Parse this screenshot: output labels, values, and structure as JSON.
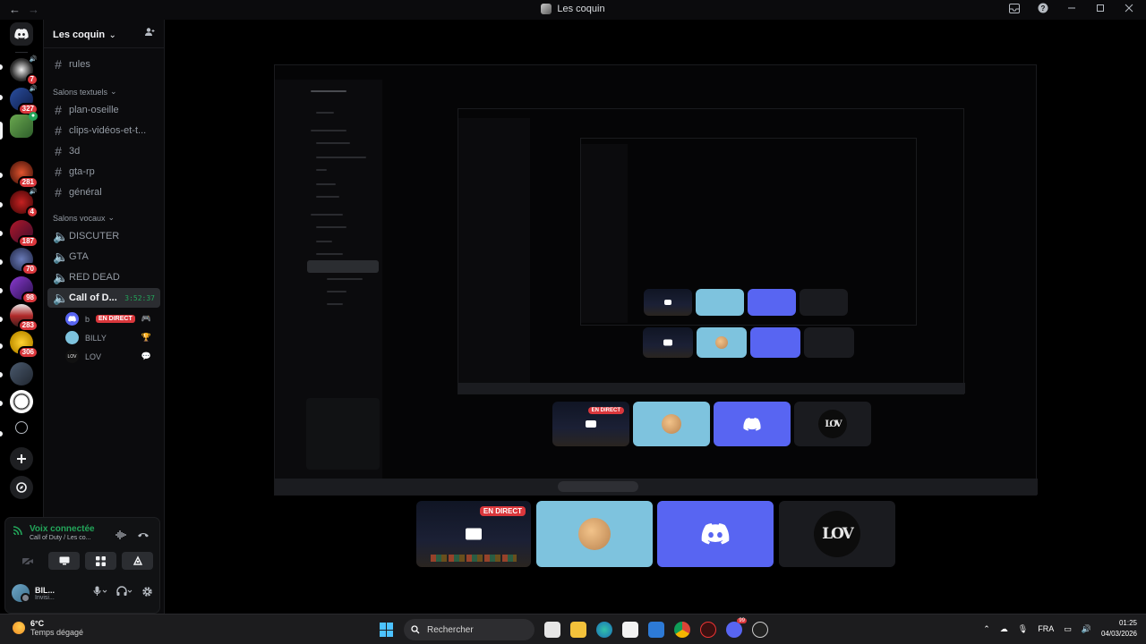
{
  "window": {
    "title": "Les coquin",
    "back_icon": "←",
    "forward_icon": "→"
  },
  "server": {
    "name": "Les coquin",
    "chevron": "⌄"
  },
  "rail": {
    "badges": [
      "7",
      "327",
      "",
      "281",
      "4",
      "187",
      "70",
      "98",
      "283",
      "306"
    ]
  },
  "channels": {
    "top": [
      {
        "name": "rules"
      }
    ],
    "text_category": "Salons textuels",
    "text": [
      {
        "name": "plan-oseille"
      },
      {
        "name": "clips-vidéos-et-t..."
      },
      {
        "name": "3d"
      },
      {
        "name": "gta-rp"
      },
      {
        "name": "général"
      }
    ],
    "voice_category": "Salons vocaux",
    "voice": [
      {
        "name": "DISCUTER"
      },
      {
        "name": "GTA"
      },
      {
        "name": "RED DEAD"
      }
    ],
    "active_voice": {
      "name": "Call of D...",
      "timer": "3:52:37"
    },
    "members": [
      {
        "name": "b",
        "live": "EN DIRECT"
      },
      {
        "name": "BILLY"
      },
      {
        "name": "LOV",
        "avatar_text": "LOV"
      }
    ]
  },
  "voice_panel": {
    "status": "Voix connectée",
    "location": "Call of Duty / Les co..."
  },
  "user": {
    "name": "BIL...",
    "status": "Invisi..."
  },
  "stream": {
    "live_label": "EN DIRECT",
    "lov_text": "LOV"
  },
  "taskbar": {
    "temp": "6°C",
    "weather": "Temps dégagé",
    "search": "Rechercher",
    "lang": "FRA",
    "time": "01:25",
    "date": "04/03/2026",
    "discord_badge": "99"
  },
  "colors": {
    "accent_green": "#23a55a",
    "live_red": "#da373c",
    "blurple": "#5865f2"
  }
}
